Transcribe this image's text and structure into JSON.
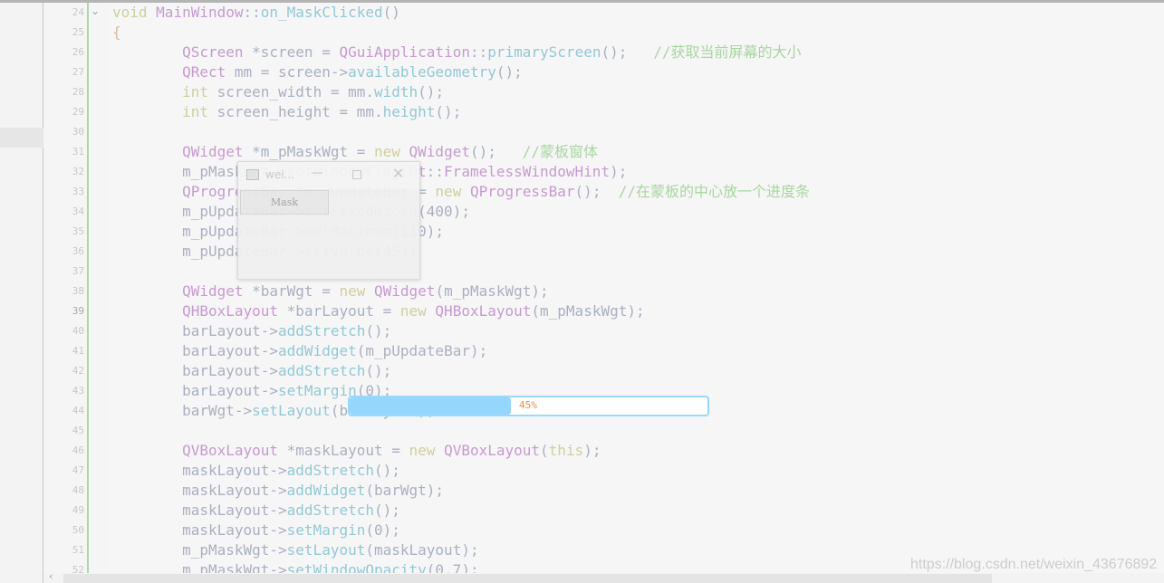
{
  "editor": {
    "first_line": 24,
    "current_line": 39,
    "lines": [
      [
        [
          "void ",
          "k"
        ],
        [
          "MainWindow",
          "t"
        ],
        [
          "::",
          "p"
        ],
        [
          "on_MaskClicked",
          "f"
        ],
        [
          "()",
          "p"
        ]
      ],
      [
        [
          "{",
          "b"
        ]
      ],
      [
        [
          "        ",
          "p"
        ],
        [
          "QScreen",
          "t"
        ],
        [
          " *screen = ",
          "p"
        ],
        [
          "QGuiApplication",
          "t"
        ],
        [
          "::",
          "p"
        ],
        [
          "primaryScreen",
          "f"
        ],
        [
          "();   ",
          "p"
        ],
        [
          "//获取当前屏幕的大小",
          "c"
        ]
      ],
      [
        [
          "        ",
          "p"
        ],
        [
          "QRect",
          "t"
        ],
        [
          " mm = screen->",
          "p"
        ],
        [
          "availableGeometry",
          "f"
        ],
        [
          "();",
          "p"
        ]
      ],
      [
        [
          "        ",
          "p"
        ],
        [
          "int",
          "k"
        ],
        [
          " screen_width = mm.",
          "p"
        ],
        [
          "width",
          "f"
        ],
        [
          "();",
          "p"
        ]
      ],
      [
        [
          "        ",
          "p"
        ],
        [
          "int",
          "k"
        ],
        [
          " screen_height = mm.",
          "p"
        ],
        [
          "height",
          "f"
        ],
        [
          "();",
          "p"
        ]
      ],
      [],
      [
        [
          "        ",
          "p"
        ],
        [
          "QWidget",
          "t"
        ],
        [
          " *m_pMaskWgt = ",
          "p"
        ],
        [
          "new ",
          "k"
        ],
        [
          "QWidget",
          "t"
        ],
        [
          "();   ",
          "p"
        ],
        [
          "//蒙板窗体",
          "c"
        ]
      ],
      [
        [
          "        ",
          "p"
        ],
        [
          "m_pMaskWgt->setWindowFlag(",
          "p"
        ],
        [
          "Qt",
          "t"
        ],
        [
          "::",
          "p"
        ],
        [
          "FramelessWindowHint",
          "t"
        ],
        [
          ");",
          "p"
        ]
      ],
      [
        [
          "        ",
          "p"
        ],
        [
          "QProgressBar",
          "t"
        ],
        [
          " *m_pUpdateBar = ",
          "p"
        ],
        [
          "new ",
          "k"
        ],
        [
          "QProgressBar",
          "t"
        ],
        [
          "();  ",
          "p"
        ],
        [
          "//在蒙板的中心放一个进度条",
          "c"
        ]
      ],
      [
        [
          "        ",
          "p"
        ],
        [
          "m_pUpdateBar->",
          "p"
        ],
        [
          "setFixedWidth",
          "f"
        ],
        [
          "(400);",
          "p"
        ]
      ],
      [
        [
          "        ",
          "p"
        ],
        [
          "m_pUpdateBar->",
          "p"
        ],
        [
          "setMaximum",
          "f"
        ],
        [
          "(110);",
          "p"
        ]
      ],
      [
        [
          "        ",
          "p"
        ],
        [
          "m_pUpdateBar->",
          "p"
        ],
        [
          "setValue",
          "f"
        ],
        [
          "(45);",
          "p"
        ]
      ],
      [],
      [
        [
          "        ",
          "p"
        ],
        [
          "QWidget",
          "t"
        ],
        [
          " *barWgt = ",
          "p"
        ],
        [
          "new ",
          "k"
        ],
        [
          "QWidget",
          "t"
        ],
        [
          "(m_pMaskWgt);",
          "p"
        ]
      ],
      [
        [
          "        ",
          "p"
        ],
        [
          "QHBoxLayout",
          "t"
        ],
        [
          " *barLayout = ",
          "p"
        ],
        [
          "new ",
          "k"
        ],
        [
          "QHBoxLayout",
          "t"
        ],
        [
          "(m_pMaskWgt);",
          "p"
        ]
      ],
      [
        [
          "        ",
          "p"
        ],
        [
          "barLayout->",
          "p"
        ],
        [
          "addStretch",
          "f"
        ],
        [
          "();",
          "p"
        ]
      ],
      [
        [
          "        ",
          "p"
        ],
        [
          "barLayout->",
          "p"
        ],
        [
          "addWidget",
          "f"
        ],
        [
          "(m_pUpdateBar);",
          "p"
        ]
      ],
      [
        [
          "        ",
          "p"
        ],
        [
          "barLayout->",
          "p"
        ],
        [
          "addStretch",
          "f"
        ],
        [
          "();",
          "p"
        ]
      ],
      [
        [
          "        ",
          "p"
        ],
        [
          "barLayout->",
          "p"
        ],
        [
          "setMargin",
          "f"
        ],
        [
          "(0);",
          "p"
        ]
      ],
      [
        [
          "        ",
          "p"
        ],
        [
          "barWgt->",
          "p"
        ],
        [
          "setLayout",
          "f"
        ],
        [
          "(barLayout);",
          "p"
        ]
      ],
      [],
      [
        [
          "        ",
          "p"
        ],
        [
          "QVBoxLayout",
          "t"
        ],
        [
          " *maskLayout = ",
          "p"
        ],
        [
          "new ",
          "k"
        ],
        [
          "QVBoxLayout",
          "t"
        ],
        [
          "(",
          "p"
        ],
        [
          "this",
          "k"
        ],
        [
          ");",
          "p"
        ]
      ],
      [
        [
          "        ",
          "p"
        ],
        [
          "maskLayout->",
          "p"
        ],
        [
          "addStretch",
          "f"
        ],
        [
          "();",
          "p"
        ]
      ],
      [
        [
          "        ",
          "p"
        ],
        [
          "maskLayout->",
          "p"
        ],
        [
          "addWidget",
          "f"
        ],
        [
          "(barWgt);",
          "p"
        ]
      ],
      [
        [
          "        ",
          "p"
        ],
        [
          "maskLayout->",
          "p"
        ],
        [
          "addStretch",
          "f"
        ],
        [
          "();",
          "p"
        ]
      ],
      [
        [
          "        ",
          "p"
        ],
        [
          "maskLayout->",
          "p"
        ],
        [
          "setMargin",
          "f"
        ],
        [
          "(0);",
          "p"
        ]
      ],
      [
        [
          "        ",
          "p"
        ],
        [
          "m_pMaskWgt->",
          "p"
        ],
        [
          "setLayout",
          "f"
        ],
        [
          "(maskLayout);",
          "p"
        ]
      ],
      [
        [
          "        ",
          "p"
        ],
        [
          "m_pMaskWgt->",
          "p"
        ],
        [
          "setWindowOpacity",
          "f"
        ],
        [
          "(0.7);",
          "p"
        ]
      ]
    ]
  },
  "dialog": {
    "title": "wei...",
    "minimize_icon": "minimize-icon",
    "maximize_icon": "maximize-icon",
    "close_icon": "close-icon",
    "mask_button": "Mask"
  },
  "progress": {
    "value": 45,
    "label": "45%",
    "fill_color": "#8cd4fc",
    "text_color": "#f28a40"
  },
  "watermark": "https://blog.csdn.net/weixin_43676892",
  "fold_icon": "chevron-down-icon"
}
